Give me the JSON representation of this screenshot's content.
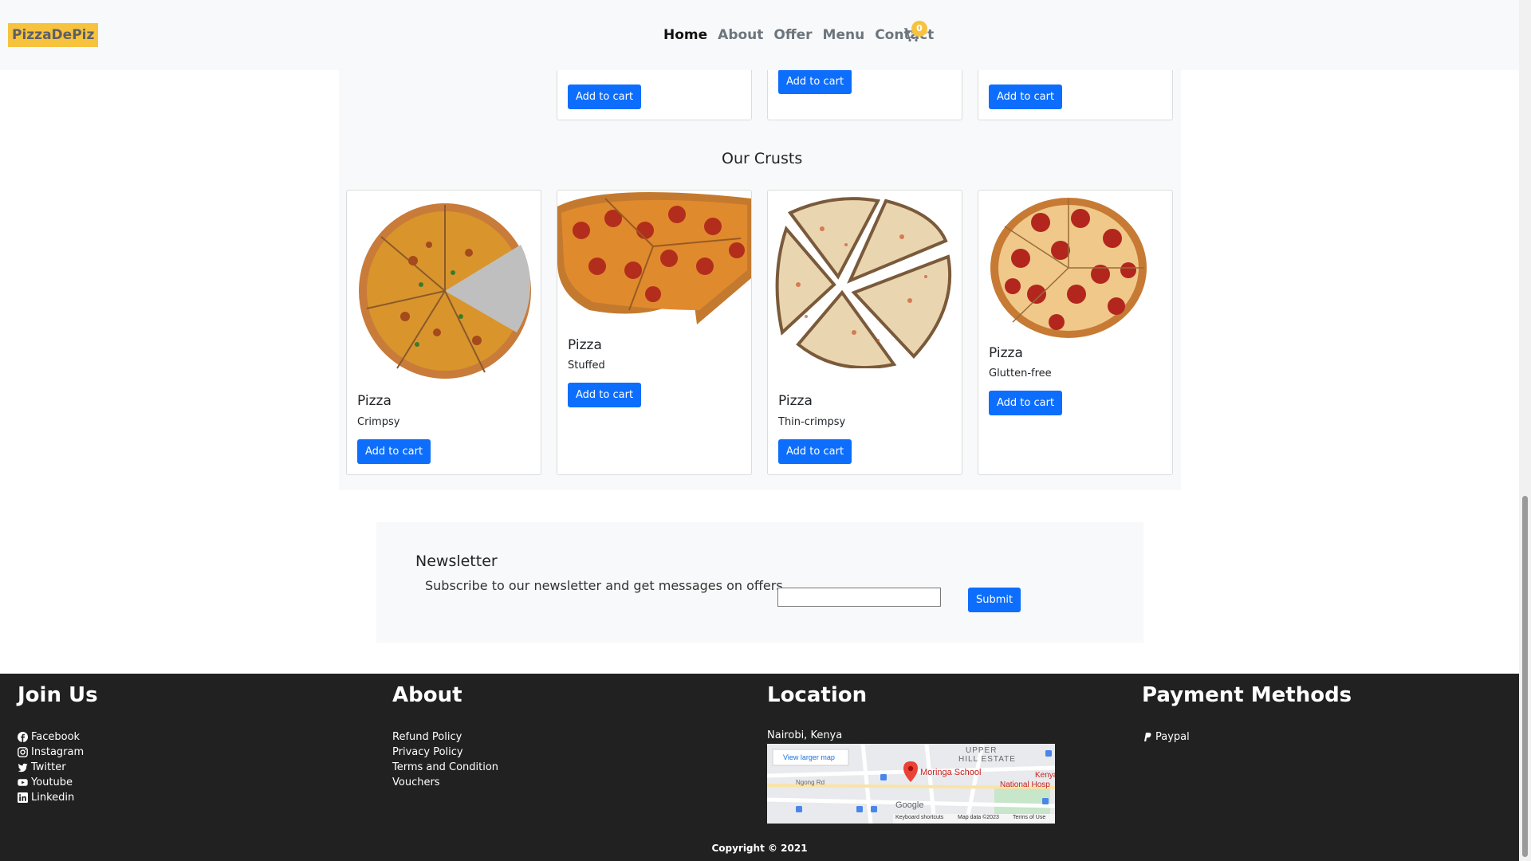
{
  "navbar": {
    "brand": "PizzaDePiz",
    "links": [
      "Home",
      "About",
      "Offer",
      "Menu",
      "Contact"
    ],
    "cart_count": "0",
    "accent": "#f7c23e"
  },
  "top_cards": {
    "buttons": [
      "Add to cart",
      "Add to cart",
      "Add to cart"
    ]
  },
  "crusts": {
    "title": "Our Crusts",
    "cards": [
      {
        "title": "Pizza",
        "text": "Crimpsy",
        "button": "Add to cart"
      },
      {
        "title": "Pizza",
        "text": "Stuffed",
        "button": "Add to cart"
      },
      {
        "title": "Pizza",
        "text": "Thin-crimpsy",
        "button": "Add to cart"
      },
      {
        "title": "Pizza",
        "text": "Glutten-free",
        "button": "Add to cart"
      }
    ]
  },
  "newsletter": {
    "title": "Newsletter",
    "text": "Subscribe to our newsletter and get messages on offers",
    "input_value": "",
    "submit": "Submit"
  },
  "footer": {
    "join": {
      "title": "Join Us",
      "items": [
        "Facebook",
        "Instagram",
        "Twitter",
        "Youtube",
        "Linkedin"
      ]
    },
    "about": {
      "title": "About",
      "items": [
        "Refund Policy",
        "Privacy Policy",
        "Terms and Condition",
        "Vouchers"
      ]
    },
    "location": {
      "title": "Location",
      "address": "Nairobi, Kenya",
      "map": {
        "view_larger": "View larger map",
        "area": "UPPER",
        "area2": "HILL ESTATE",
        "place": "Moringa School",
        "road": "Ngong Rd",
        "hospital": "Kenya",
        "hospital2": "National Hosp",
        "google": "Google",
        "shortcuts": "Keyboard shortcuts",
        "mapdata": "Map data ©2023",
        "terms": "Terms of Use"
      }
    },
    "payment": {
      "title": "Payment Methods",
      "items": [
        "Paypal"
      ]
    },
    "copyright": "Copyright © 2021"
  },
  "colors": {
    "button": "#0d6efd",
    "footer": "#212121",
    "brand": "#f7c23e"
  }
}
